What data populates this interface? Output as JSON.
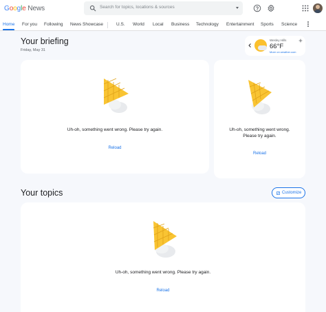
{
  "header": {
    "logo_parts": [
      "G",
      "o",
      "o",
      "g",
      "l",
      "e"
    ],
    "logo_news": "News",
    "search_placeholder": "Search for topics, locations & sources"
  },
  "nav": {
    "items": [
      "Home",
      "For you",
      "Following",
      "News Showcase",
      "U.S.",
      "World",
      "Local",
      "Business",
      "Technology",
      "Entertainment",
      "Sports",
      "Science"
    ]
  },
  "briefing": {
    "title": "Your briefing",
    "date": "Friday, May 31"
  },
  "weather": {
    "location": "Wesley Hills",
    "temperature": "66°F",
    "more_link": "More on weather.com"
  },
  "cards": {
    "error_text": "Uh-oh, something went wrong. Please try again.",
    "error_text_line1": "Uh-oh, something went wrong.",
    "error_text_line2": "Please try again.",
    "reload_label": "Reload"
  },
  "topics": {
    "title": "Your topics",
    "customize_label": "Customize"
  },
  "colors": {
    "accent": "#1a73e8",
    "cone": "#f9c433",
    "background": "#f6f8fc"
  },
  "icons": [
    "search-icon",
    "help-icon",
    "settings-icon",
    "apps-icon",
    "more-vert-icon",
    "chevron-left-icon",
    "add-icon",
    "edit-icon"
  ]
}
